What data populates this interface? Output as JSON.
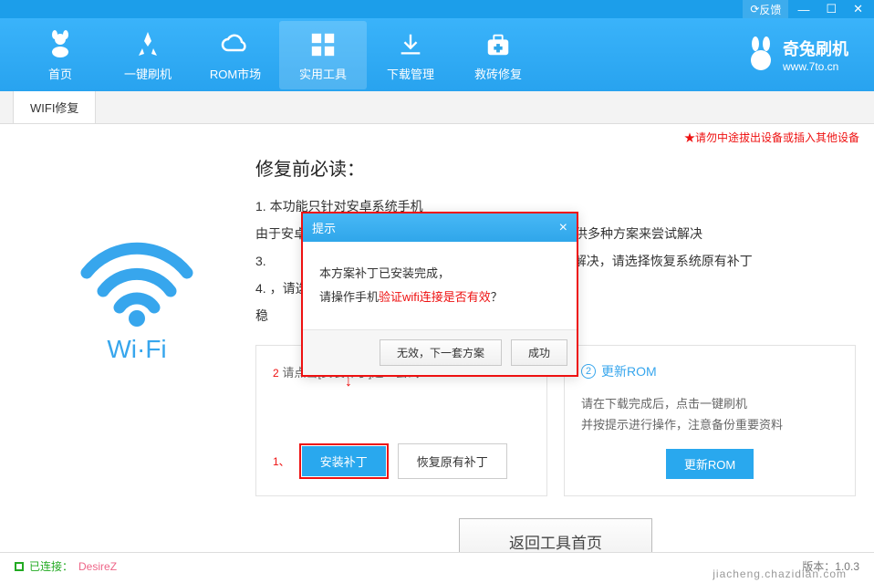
{
  "titlebar": {
    "feedback": "反馈"
  },
  "nav": {
    "items": [
      {
        "label": "首页"
      },
      {
        "label": "一键刷机"
      },
      {
        "label": "ROM市场"
      },
      {
        "label": "实用工具"
      },
      {
        "label": "下载管理"
      },
      {
        "label": "救砖修复"
      }
    ]
  },
  "brand": {
    "title": "奇兔刷机",
    "url": "www.7to.cn"
  },
  "tab": {
    "label": "WIFI修复"
  },
  "warning": "★请勿中途拔出设备或插入其他设备",
  "wifi_label": "Wi·Fi",
  "section_title": "修复前必读：",
  "instructions": {
    "l1": "1. 本功能只针对安卓系统手机",
    "l2": "由于安卓系统的版本众多，手机硬件的复杂性，我们会提供多种方案来尝试解决",
    "l3_pre": "3. ",
    "l3_post": "后，还是无法解决，请选择恢复系统原有补丁",
    "l4": "4. ，请选择更新ROM方式解决，此方法较为彻底",
    "l5": "稳"
  },
  "cards": {
    "left": {
      "num": "1",
      "desc": "请点击[安装补丁]逐一尝试",
      "note_prefix": "2",
      "note1_prefix": "1、",
      "btn1": "安装补丁",
      "btn2": "恢复原有补丁"
    },
    "right": {
      "num": "2",
      "title": "更新ROM",
      "desc1": "请在下载完成后，点击一键刷机",
      "desc2": "并按提示进行操作，注意备份重要资料",
      "btn": "更新ROM"
    }
  },
  "back_btn": "返回工具首页",
  "dialog": {
    "title": "提示",
    "line1": "本方案补丁已安装完成，",
    "line2_pre": "请操作手机",
    "line2_red": "验证wifi连接是否有效",
    "line2_post": "？",
    "btn1": "无效，下一套方案",
    "btn2": "成功"
  },
  "status": {
    "connected": "已连接：",
    "device": "DesireZ",
    "version": "版本：1.0.3"
  },
  "watermark": "jiacheng.chazidian.com",
  "arrow_note": "↓"
}
